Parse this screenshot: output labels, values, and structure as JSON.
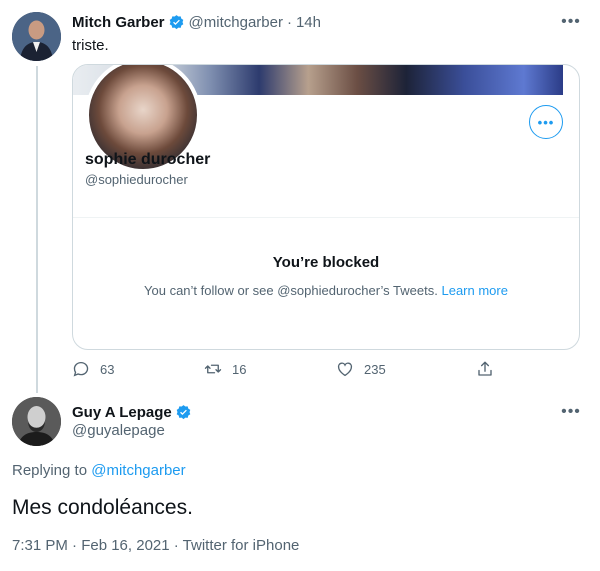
{
  "tweet1": {
    "author_name": "Mitch Garber",
    "handle": "@mitchgarber",
    "separator": "·",
    "time": "14h",
    "text": "triste.",
    "more_icon": "more-horizontal-icon",
    "card": {
      "name": "sophie durocher",
      "handle": "@sophiedurocher",
      "blocked_title": "You’re blocked",
      "blocked_desc": "You can’t follow or see @sophiedurocher’s Tweets.",
      "learn_more": "Learn more"
    },
    "actions": {
      "replies": "63",
      "retweets": "16",
      "likes": "235"
    }
  },
  "tweet2": {
    "author_name": "Guy A Lepage",
    "handle": "@guyalepage",
    "replying_prefix": "Replying to",
    "replying_to": "@mitchgarber",
    "text": "Mes condoléances.",
    "meta": "7:31 PM · Feb 16, 2021 · Twitter for iPhone"
  },
  "colors": {
    "accent": "#1d9bf0",
    "secondary_text": "#536471",
    "border": "#cfd9de"
  }
}
